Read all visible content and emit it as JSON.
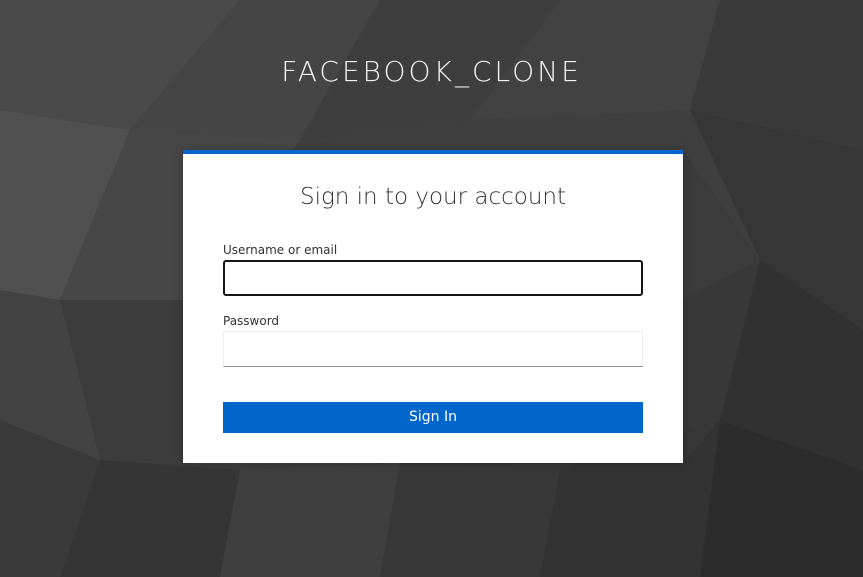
{
  "brand": {
    "title": "FACEBOOK_CLONE"
  },
  "login": {
    "heading": "Sign in to your account",
    "username_label": "Username or email",
    "username_value": "",
    "password_label": "Password",
    "password_value": "",
    "submit_label": "Sign In"
  },
  "colors": {
    "accent": "#0066cc",
    "background": "#3f3f3f",
    "card": "#ffffff",
    "text": "#333333"
  }
}
